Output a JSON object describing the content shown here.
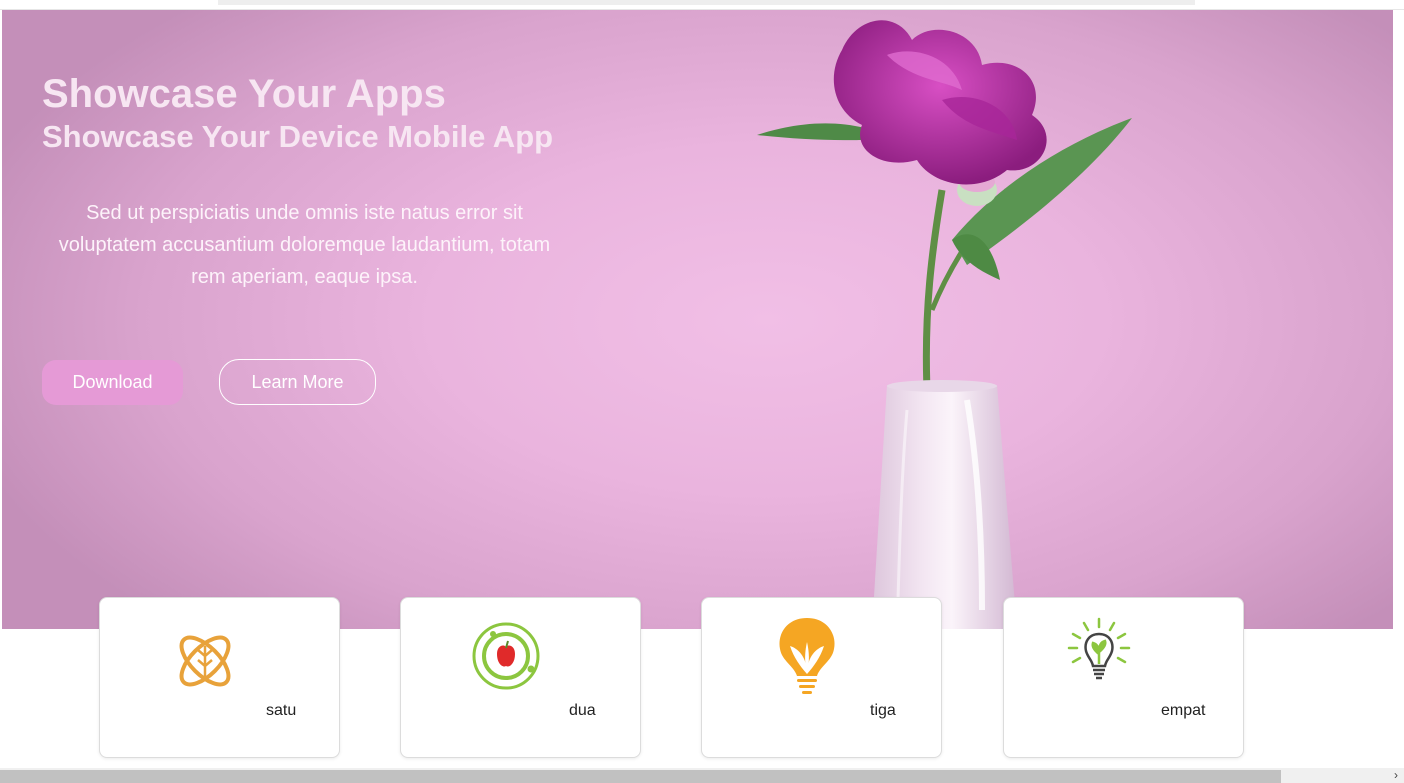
{
  "hero": {
    "title": "Showcase Your Apps",
    "subtitle": "Showcase Your Device Mobile App",
    "description": "Sed ut perspiciatis unde omnis iste natus error sit voluptatem accusantium doloremque laudantium, totam rem aperiam, eaque ipsa.",
    "download_label": "Download",
    "learn_more_label": "Learn More",
    "image": "pink-flower-in-white-vase"
  },
  "cards": [
    {
      "label": "satu",
      "icon": "atom-leaf-icon",
      "color": "#e8a23a"
    },
    {
      "label": "dua",
      "icon": "apple-orbit-icon",
      "color": "#8cc63f"
    },
    {
      "label": "tiga",
      "icon": "bulb-leaf-icon",
      "color": "#f5a623"
    },
    {
      "label": "empat",
      "icon": "lightbulb-sprout-icon",
      "color": "#8cc63f"
    }
  ],
  "colors": {
    "hero_bg": "#eab4de",
    "download_bg": "#e59ad6",
    "text_light": "#f7e6f2"
  }
}
